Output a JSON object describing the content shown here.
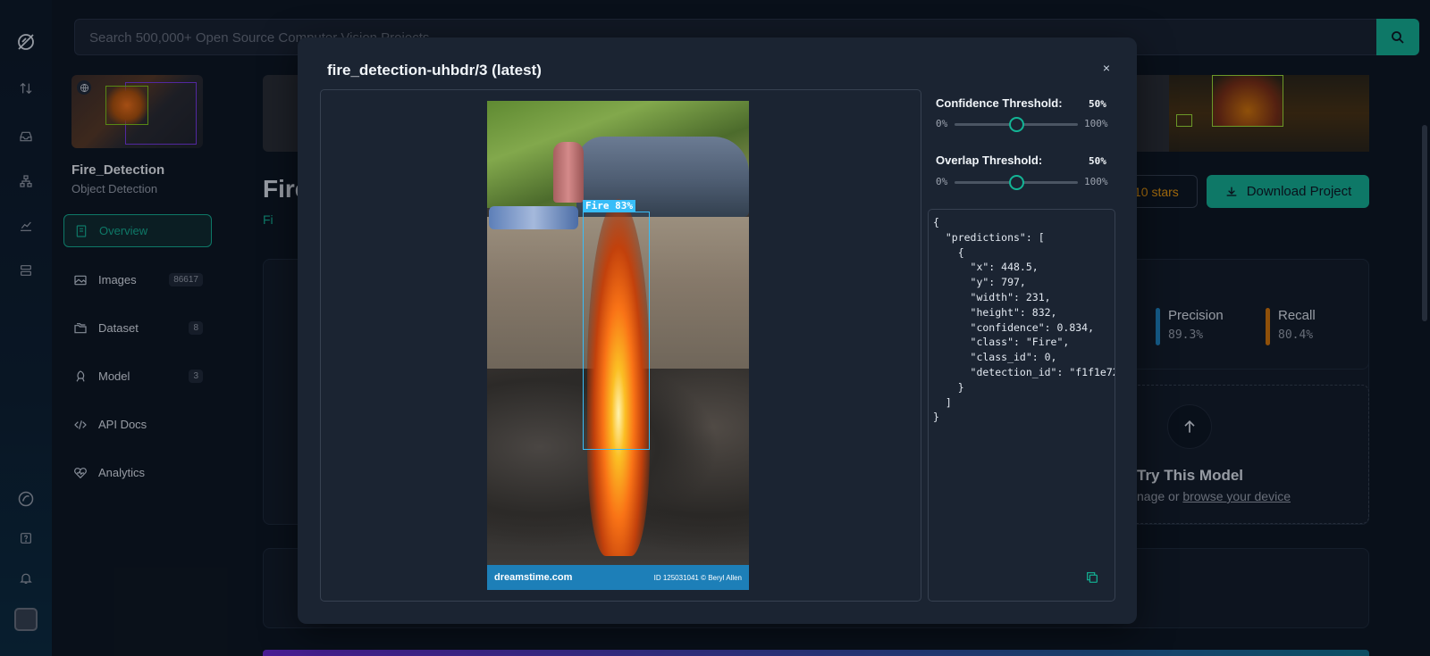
{
  "search": {
    "placeholder": "Search 500,000+ Open Source Computer Vision Projects"
  },
  "rail": {
    "icons": [
      "logo-icon",
      "sort-icon",
      "inbox-icon",
      "sitemap-icon",
      "chart-icon",
      "server-icon",
      "brand-icon",
      "help-icon",
      "bell-icon",
      "avatar"
    ]
  },
  "project": {
    "name": "Fire_Detection",
    "type": "Object Detection",
    "title_partial": "Fire",
    "subtitle_partial": "Fi",
    "nav": [
      {
        "label": "Overview",
        "icon": "book-icon",
        "count": ""
      },
      {
        "label": "Images",
        "icon": "image-icon",
        "count": "86617"
      },
      {
        "label": "Dataset",
        "icon": "folders-icon",
        "count": "8"
      },
      {
        "label": "Model",
        "icon": "rocket-icon",
        "count": "3"
      },
      {
        "label": "API Docs",
        "icon": "code-icon",
        "count": ""
      },
      {
        "label": "Analytics",
        "icon": "heart-pulse-icon",
        "count": ""
      }
    ]
  },
  "main": {
    "stars_label": "10 stars",
    "download_label": "Download Project",
    "metrics": [
      {
        "label": "Precision",
        "value": "89.3%",
        "color": "#1e88c7"
      },
      {
        "label": "Recall",
        "value": "80.4%",
        "color": "#d97706"
      }
    ],
    "try_title": "Try This Model",
    "try_sub_prefix": "nage or ",
    "try_sub_link": "browse your device"
  },
  "modal": {
    "title": "fire_detection-uhbdr/3 (latest)",
    "close": "×",
    "detection_label": "Fire 83%",
    "watermark_brand": "dreamstime.com",
    "watermark_credit": "ID 125031041 © Beryl Allen",
    "confidence": {
      "label": "Confidence Threshold:",
      "value": "50%",
      "min": "0%",
      "max": "100%",
      "fraction": 0.5
    },
    "overlap": {
      "label": "Overlap Threshold:",
      "value": "50%",
      "min": "0%",
      "max": "100%",
      "fraction": 0.5
    },
    "json_output": "{\n  \"predictions\": [\n    {\n      \"x\": 448.5,\n      \"y\": 797,\n      \"width\": 231,\n      \"height\": 832,\n      \"confidence\": 0.834,\n      \"class\": \"Fire\",\n      \"class_id\": 0,\n      \"detection_id\": \"f1f1e72\n    }\n  ]\n}"
  },
  "colors": {
    "accent": "#13b495",
    "box": "#38bdf8",
    "background": "#0c1420",
    "modal": "#1b2432"
  }
}
